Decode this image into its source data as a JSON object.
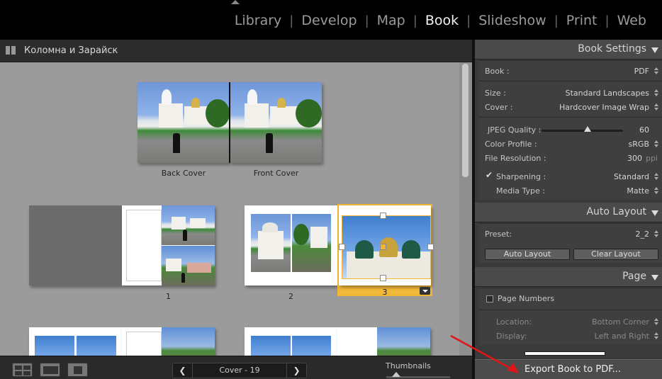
{
  "modules": [
    "Library",
    "Develop",
    "Map",
    "Book",
    "Slideshow",
    "Print",
    "Web"
  ],
  "active_module": "Book",
  "document": {
    "title": "Коломна и Зарайск"
  },
  "spreads": {
    "back_cover": "Back Cover",
    "front_cover": "Front Cover",
    "page_1": "1",
    "page_2": "2",
    "page_3": "3"
  },
  "toolbar": {
    "pager_label": "Cover - 19",
    "prev_icon": "chevron-left-icon",
    "next_icon": "chevron-right-icon",
    "thumbnails_label": "Thumbnails"
  },
  "book_settings": {
    "title": "Book Settings",
    "book_label": "Book :",
    "book_value": "PDF",
    "size_label": "Size :",
    "size_value": "Standard Landscapes",
    "cover_label": "Cover :",
    "cover_value": "Hardcover Image Wrap",
    "jpeg_quality_label": "JPEG Quality :",
    "jpeg_quality_value": "60",
    "color_profile_label": "Color Profile :",
    "color_profile_value": "sRGB",
    "file_resolution_label": "File Resolution :",
    "file_resolution_value": "300",
    "file_resolution_unit": "ppi",
    "sharpening_label": "Sharpening :",
    "sharpening_value": "Standard",
    "sharpening_checked": true,
    "media_type_label": "Media Type :",
    "media_type_value": "Matte"
  },
  "auto_layout": {
    "title": "Auto Layout",
    "preset_label": "Preset:",
    "preset_value": "2_2",
    "auto_layout_button": "Auto Layout",
    "clear_layout_button": "Clear Layout"
  },
  "page_section": {
    "title": "Page",
    "page_numbers_label": "Page Numbers",
    "page_numbers_checked": false,
    "location_label": "Location:",
    "location_value": "Bottom Corner",
    "display_label": "Display:",
    "display_value": "Left and Right"
  },
  "export": {
    "label": "Export Book to PDF..."
  },
  "colors": {
    "selection": "#f1b93a",
    "annotation_arrow": "#e01515"
  }
}
